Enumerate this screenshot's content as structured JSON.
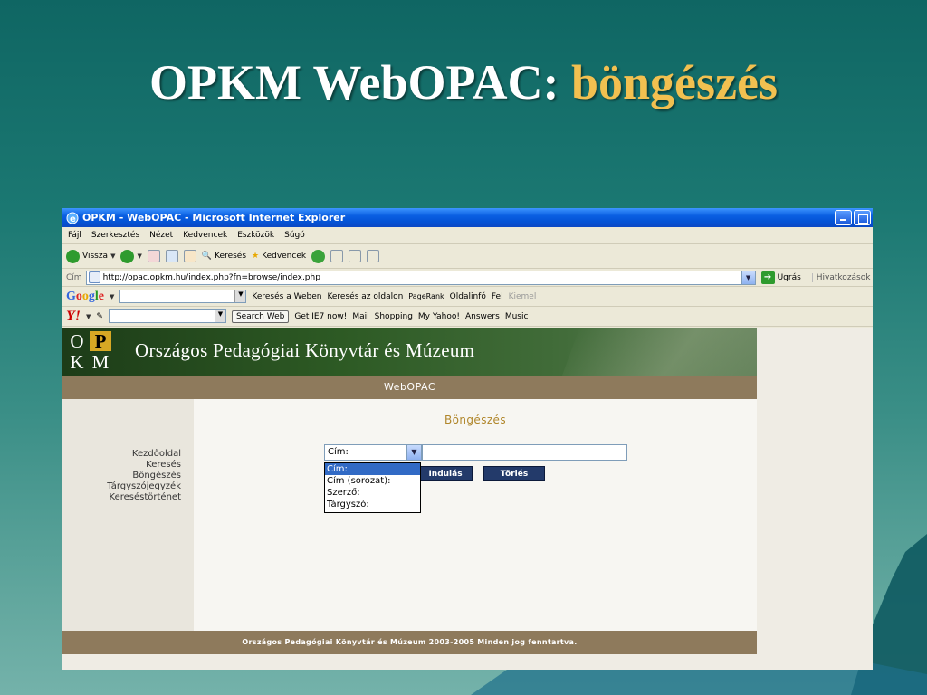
{
  "slide": {
    "title_main": "OPKM WebOPAC: ",
    "title_accent": "böngészés",
    "accent_color": "#f2c050"
  },
  "browser": {
    "window_title": "OPKM - WebOPAC - Microsoft Internet Explorer",
    "menu": [
      "Fájl",
      "Szerkesztés",
      "Nézet",
      "Kedvencek",
      "Eszközök",
      "Súgó"
    ],
    "toolbar": {
      "back_label": "Vissza",
      "search_label": "Keresés",
      "favorites_label": "Kedvencek"
    },
    "address": {
      "label": "Cím",
      "url": "http://opac.opkm.hu/index.php?fn=browse/index.php",
      "go_label": "Ugrás",
      "links_label": "Hivatkozások"
    },
    "google_bar": {
      "search_web": "Keresés a Weben",
      "search_site": "Keresés az oldalon",
      "pagerank": "PageRank",
      "pageinfo": "Oldalinfó",
      "up": "Fel",
      "highlight": "Kiemel"
    },
    "yahoo_bar": {
      "search_web": "Search Web",
      "get_ie7": "Get IE7 now!",
      "mail": "Mail",
      "shopping": "Shopping",
      "my_yahoo": "My Yahoo!",
      "answers": "Answers",
      "music": "Music"
    }
  },
  "page": {
    "banner_title": "Országos Pedagógiai Könyvtár és Múzeum",
    "logo_letters": [
      "O",
      "P",
      "K",
      "M"
    ],
    "opac_label": "WebOPAC",
    "nav": [
      "Kezdőoldal",
      "Keresés",
      "Böngészés",
      "Tárgyszójegyzék",
      "Kereséstörténet"
    ],
    "content_title": "Böngészés",
    "select_value": "Cím:",
    "dropdown_options": [
      "Cím:",
      "Cím (sorozat):",
      "Szerző:",
      "Tárgyszó:"
    ],
    "go_button": "Indulás",
    "clear_button": "Törlés",
    "footer": "Országos Pedagógiai Könyvtár és Múzeum 2003-2005 Minden jog fenntartva."
  }
}
